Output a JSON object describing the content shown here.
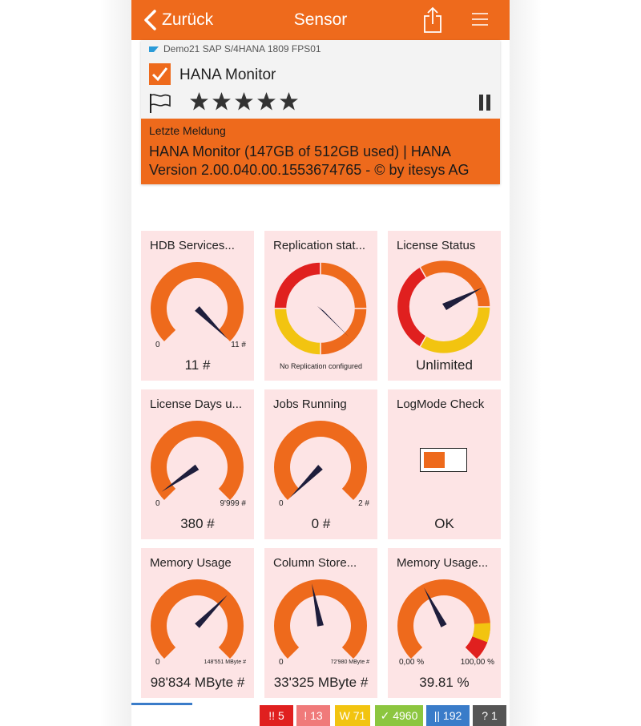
{
  "navbar": {
    "back_label": "Zurück",
    "title": "Sensor"
  },
  "sensor": {
    "system": "Demo21 SAP S/4HANA 1809 FPS01",
    "name": "HANA Monitor",
    "rating": "5 of 5 stars",
    "message_title": "Letzte Meldung",
    "message_text": "HANA Monitor (147GB of 512GB used) | HANA Version 2.00.040.00.1553674765 - © by itesys AG"
  },
  "colors": {
    "accent": "#ee6a1c",
    "tile_bg": "#fde4e5",
    "red": "#e0201f",
    "yellow": "#f2c410"
  },
  "tiles": [
    {
      "title": "HDB Services...",
      "min": "0",
      "max": "11 #",
      "value": "11 #",
      "needle_pct": 1.0
    },
    {
      "title": "Replication stat...",
      "note": "No Replication configured"
    },
    {
      "title": "License Status",
      "value": "Unlimited"
    },
    {
      "title": "License Days u...",
      "min": "0",
      "max": "9'999 #",
      "value": "380 #",
      "needle_pct": 0.038
    },
    {
      "title": "Jobs Running",
      "min": "0",
      "max": "2 #",
      "value": "0 #",
      "needle_pct": 0.0
    },
    {
      "title": "LogMode Check",
      "value": "OK"
    },
    {
      "title": "Memory Usage",
      "min": "0",
      "max": "148'551 MByte #",
      "value": "98'834 MByte #",
      "needle_pct": 0.665
    },
    {
      "title": "Column Store...",
      "min": "0",
      "max": "72'980 MByte #",
      "value": "33'325 MByte #",
      "needle_pct": 0.457
    },
    {
      "title": "Memory Usage...",
      "min": "0,00 %",
      "max": "100,00 %",
      "value": "39.81 %",
      "needle_pct": 0.398
    }
  ],
  "status_bar": [
    {
      "icon": "!!",
      "count": "5",
      "color": "#e0201f"
    },
    {
      "icon": "!",
      "count": "13",
      "color": "#f07a7a"
    },
    {
      "icon": "W",
      "count": "71",
      "color": "#f2c410"
    },
    {
      "icon": "✓",
      "count": "4960",
      "color": "#8cc63f"
    },
    {
      "icon": "||",
      "count": "192",
      "color": "#3a7cc9"
    },
    {
      "icon": "?",
      "count": "1",
      "color": "#555555"
    }
  ]
}
